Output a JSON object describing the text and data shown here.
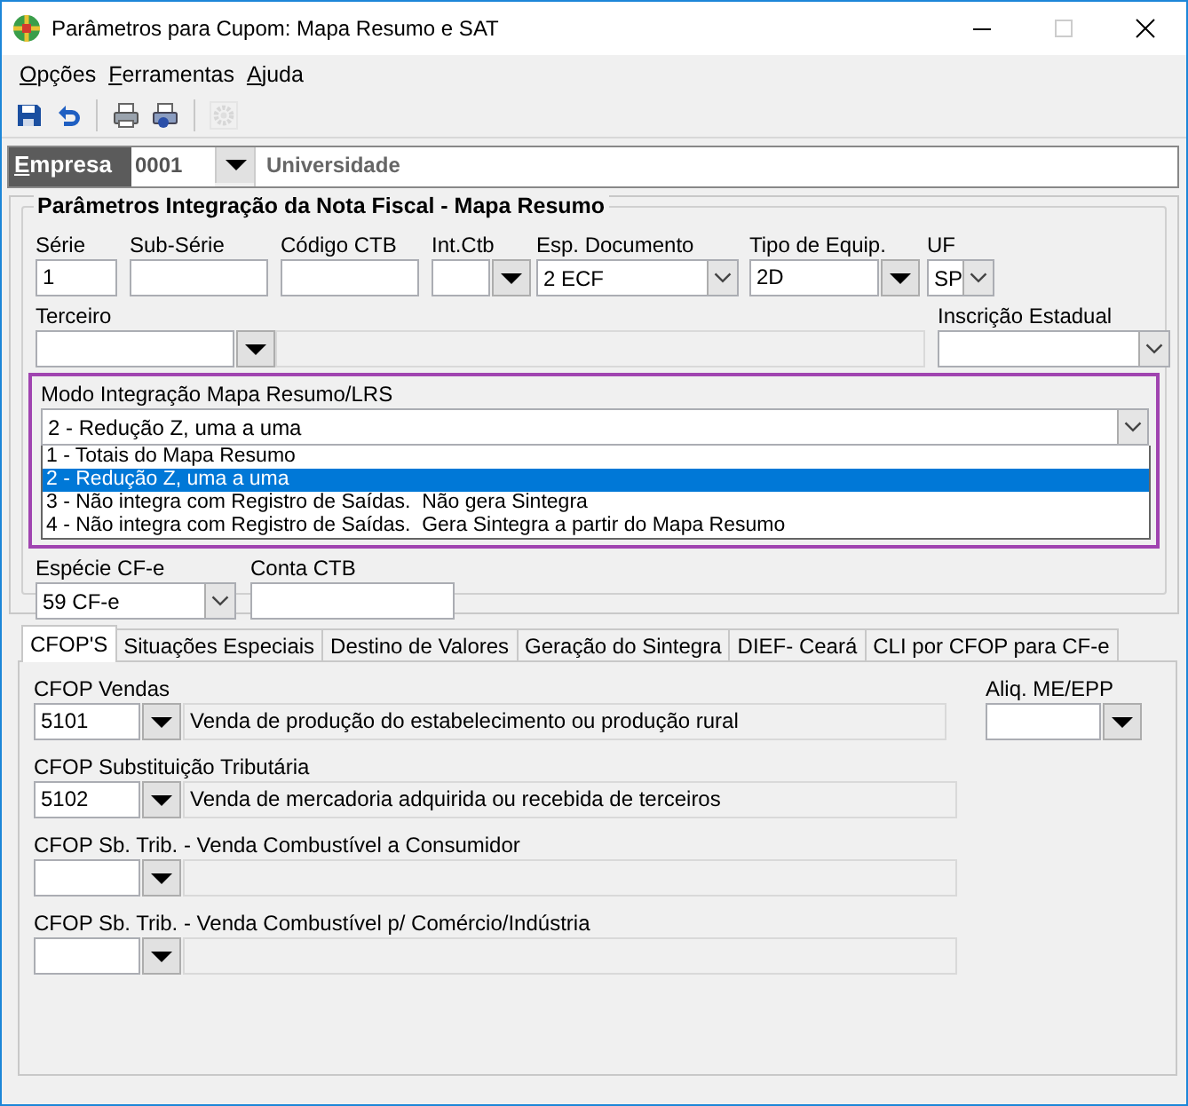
{
  "window": {
    "title": "Parâmetros para Cupom: Mapa Resumo e SAT"
  },
  "menu": [
    {
      "label": "Opções"
    },
    {
      "label": "Ferramentas"
    },
    {
      "label": "Ajuda"
    }
  ],
  "toolbar": [
    {
      "kind": "save",
      "disabled": false
    },
    {
      "kind": "undo",
      "disabled": false
    },
    {
      "kind": "print",
      "disabled": false
    },
    {
      "kind": "print_setup",
      "disabled": false
    },
    {
      "kind": "gear",
      "disabled": true
    }
  ],
  "empresa": {
    "label": "Empresa",
    "code": "0001",
    "name": "Universidade"
  },
  "integration": {
    "title": "Parâmetros Integração da Nota Fiscal - Mapa Resumo",
    "row1": [
      {
        "label": "Série",
        "value": "1",
        "kind": "text"
      },
      {
        "label": "Sub-Série",
        "kind": "text"
      },
      {
        "label": "Código CTB",
        "kind": "text"
      },
      {
        "label": "Int.Ctb",
        "kind": "combo"
      },
      {
        "label": "Esp. Documento",
        "value": "2 ECF",
        "kind": "select"
      },
      {
        "label": "Tipo de Equip.",
        "value": "2D",
        "kind": "combo"
      },
      {
        "label": "UF",
        "value": "SP",
        "kind": "select"
      }
    ],
    "terceiro": {
      "label": "Terceiro"
    },
    "inscricao": {
      "label": "Inscrição Estadual"
    },
    "modo": {
      "label": "Modo Integração Mapa Resumo/LRS",
      "value": "2 - Redução Z, uma a uma",
      "highlighted": true,
      "expanded": true,
      "options": [
        {
          "label": "1 - Totais do Mapa Resumo",
          "selected": false
        },
        {
          "label": "2 - Redução Z, uma a uma",
          "selected": true
        },
        {
          "label": "3 - Não integra com Registro de Saídas.  Não gera Sintegra",
          "selected": false
        },
        {
          "label": "4 - Não integra com Registro de Saídas.  Gera Sintegra a partir do Mapa Resumo",
          "selected": false
        }
      ]
    },
    "especie": {
      "label": "Espécie CF-e",
      "value": "59 CF-e"
    },
    "conta": {
      "label": "Conta CTB"
    }
  },
  "tabs": [
    {
      "label": "CFOP'S",
      "selected": true
    },
    {
      "label": "Situações Especiais",
      "selected": false
    },
    {
      "label": "Destino de Valores",
      "selected": false
    },
    {
      "label": "Geração do Sintegra",
      "selected": false
    },
    {
      "label": "DIEF- Ceará",
      "selected": false
    },
    {
      "label": "CLI por CFOP para CF-e",
      "selected": false
    }
  ],
  "cfop": [
    {
      "label": "CFOP Vendas",
      "code": "5101",
      "description": "Venda de produção do estabelecimento ou produção rural"
    },
    {
      "label": "CFOP Substituição Tributária",
      "code": "5102",
      "description": "Venda de mercadoria adquirida ou recebida de terceiros"
    },
    {
      "label": "CFOP Sb. Trib. - Venda Combustível a Consumidor"
    },
    {
      "label": "CFOP Sb. Trib. - Venda Combustível p/ Comércio/Indústria"
    }
  ],
  "aliq": {
    "label": "Aliq. ME/EPP"
  }
}
